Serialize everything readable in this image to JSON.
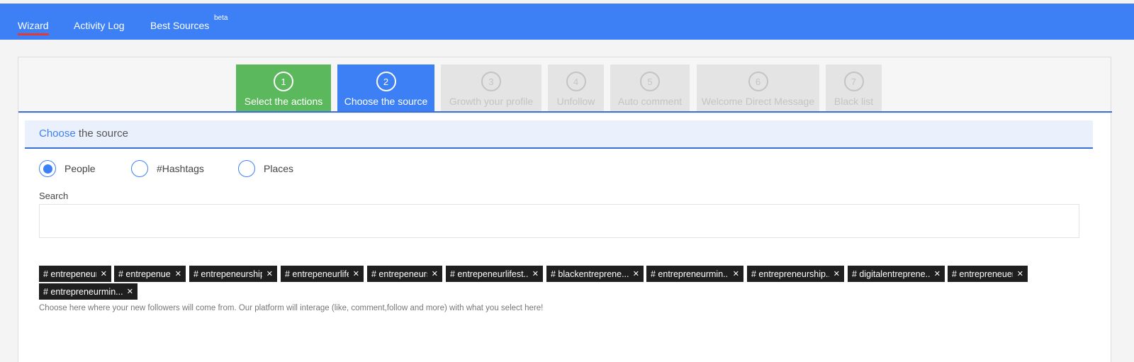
{
  "nav": {
    "tabs": [
      {
        "label": "Wizard"
      },
      {
        "label": "Activity Log"
      },
      {
        "label": "Best Sources"
      }
    ],
    "beta_badge": "beta"
  },
  "wizard": {
    "steps": [
      {
        "number": "1",
        "label": "Select the actions",
        "state": "done"
      },
      {
        "number": "2",
        "label": "Choose the source",
        "state": "current"
      },
      {
        "number": "3",
        "label": "Growth your profile",
        "state": "pending"
      },
      {
        "number": "4",
        "label": "Unfollow",
        "state": "pending"
      },
      {
        "number": "5",
        "label": "Auto comment",
        "state": "pending"
      },
      {
        "number": "6",
        "label": "Welcome Direct Message",
        "state": "pending"
      },
      {
        "number": "7",
        "label": "Black list",
        "state": "pending"
      }
    ]
  },
  "section": {
    "title_accent": "Choose",
    "title_rest": " the source"
  },
  "source_type": {
    "options": [
      {
        "label": "People",
        "checked": true
      },
      {
        "label": "#Hashtags",
        "checked": false
      },
      {
        "label": "Places",
        "checked": false
      }
    ]
  },
  "search": {
    "label": "Search",
    "value": "",
    "placeholder": ""
  },
  "tags": [
    "# entrepeneur",
    "# entrepenuer",
    "# entrepeneurship",
    "# entrepeneurlife",
    "# entrepeneurs",
    "# entrepeneurlifest...",
    "# blackentreprene...",
    "# entrepreneurmin...",
    "# entrepreneurship...",
    "# digitalentreprene...",
    "# entrepreneuer",
    "# entrepreneurmin..."
  ],
  "hint": "Choose here where your new followers will come from. Our platform will interage (like, comment,follow and more) with what you select here!",
  "colors": {
    "brand": "#3d80f5",
    "done": "#5cb85c",
    "pending": "#e4e4e4",
    "tag_bg": "#1f1f1f"
  }
}
